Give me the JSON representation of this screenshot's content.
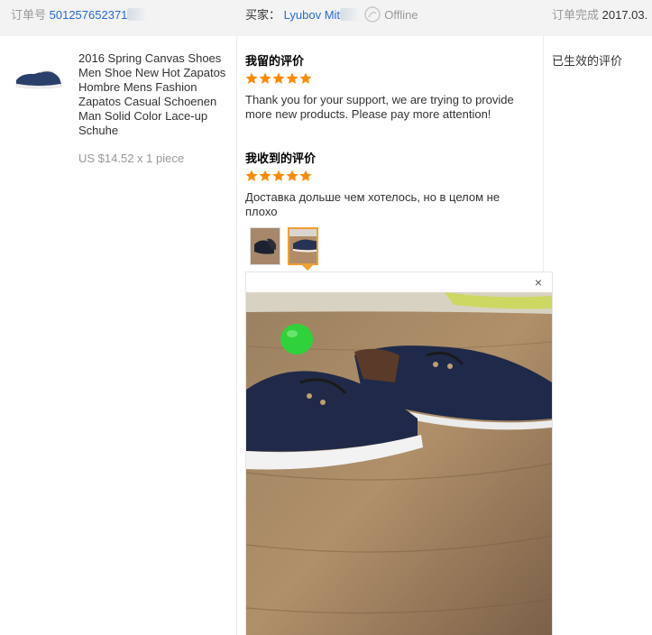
{
  "header": {
    "order_label": "订单号",
    "order_number": "501257652371",
    "buyer_label": "买家：",
    "buyer_name": "Lyubov Mit",
    "buyer_status": "Offline",
    "completed_label": "订单完成",
    "completed_date": "2017.03."
  },
  "product": {
    "title": "2016 Spring Canvas Shoes Men Shoe New Hot Zapatos Hombre Mens Fashion Zapatos Casual Schoenen Man Solid Color Lace-up Schuhe",
    "price_line": "US $14.52 x 1 piece"
  },
  "my_review": {
    "heading": "我留的评价",
    "rating": 5,
    "text": "Thank you for your support, we are trying to provide more new products. Please pay more attention!"
  },
  "received_review": {
    "heading": "我收到的评价",
    "rating": 5,
    "text": "Доставка дольше чем хотелось, но в целом не плохо"
  },
  "status": {
    "label": "已生效的评价"
  },
  "viewer": {
    "close_symbol": "×"
  },
  "colors": {
    "link": "#2a6ad1",
    "star": "#ff8a00",
    "header_bg": "#f3f3f3",
    "active_thumb": "#f0a030"
  },
  "icons": {
    "star": "star-icon",
    "offline": "offline-status-icon",
    "close": "close-icon"
  }
}
